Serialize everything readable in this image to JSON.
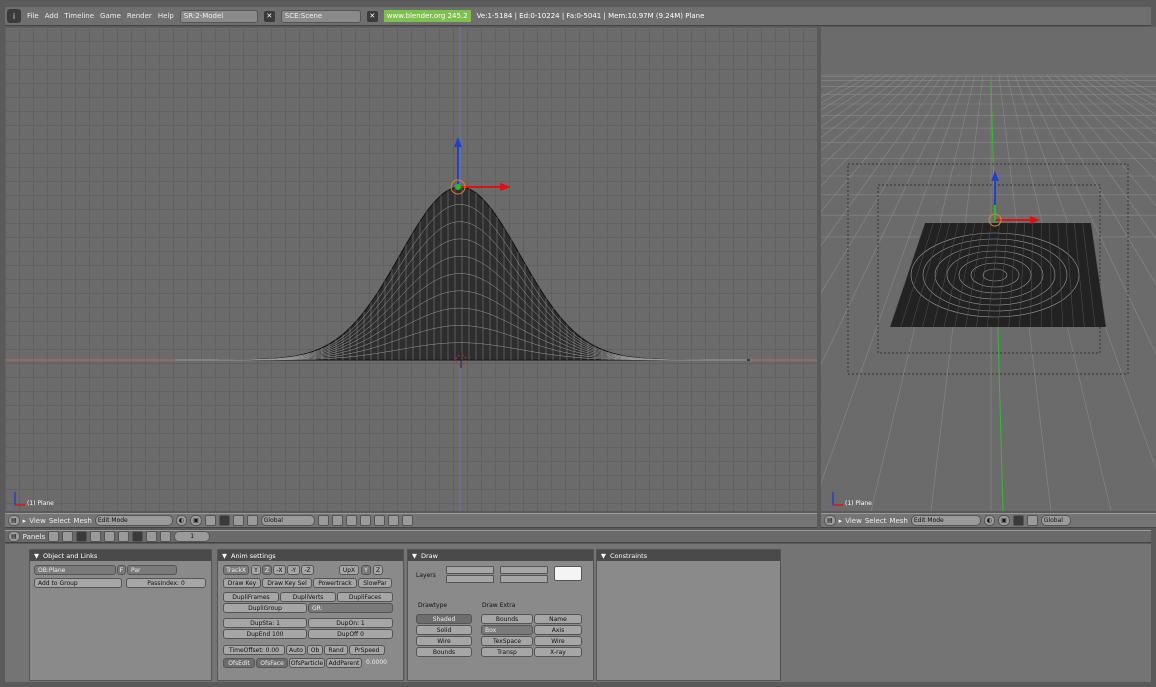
{
  "topbar": {
    "menus": [
      "File",
      "Add",
      "Timeline",
      "Game",
      "Render",
      "Help"
    ],
    "screen": "SR:2-Model",
    "scene": "SCE:Scene",
    "url": "www.blender.org 245.2",
    "stats": "Ve:1-5184 | Ed:0-10224 | Fa:0-5041 | Mem:10.97M (9.24M) Plane"
  },
  "left_view": {
    "label": "(1) Plane"
  },
  "right_view": {
    "label": "(1) Plane"
  },
  "view_header": {
    "view": "View",
    "select": "Select",
    "mesh": "Mesh",
    "mode": "Edit Mode",
    "orient": "Global"
  },
  "right_header": {
    "view": "View",
    "select": "Select",
    "mesh": "Mesh",
    "mode": "Edit Mode",
    "orient": "Global"
  },
  "buttons_header": {
    "panels": "Panels",
    "frame": "1"
  },
  "panels": {
    "object_links": {
      "title": "Object and Links",
      "ob": "OB:Plane",
      "f": "F",
      "par": "Par",
      "add_group": "Add to Group",
      "pass_index": "PassIndex: 0"
    },
    "anim": {
      "title": "Anim settings",
      "track": "TrackX",
      "track_axes": [
        "Y",
        "Z",
        "-X",
        "-Y",
        "-Z"
      ],
      "up": "UpX",
      "upy": "Y",
      "upz": "Z",
      "row2": [
        "Draw Key",
        "Draw Key Sel",
        "Powertrack",
        "SlowPar"
      ],
      "row3": [
        "DupliFrames",
        "DupliVerts",
        "DupliFaces"
      ],
      "dupligroup": "DupliGroup",
      "gr": "GR:",
      "dupsta": "DupSta: 1",
      "dupon": "DupOn: 1",
      "dupend": "DupEnd 100",
      "dupoff": "DupOff 0",
      "timeoffset": "TimeOffset: 0.00",
      "row7": [
        "Auto",
        "Ob",
        "Rand",
        "PrSpeed"
      ],
      "row8": [
        "OfsEdit",
        "OfsFace",
        "OfsParticle",
        "AddParent"
      ],
      "speed": "0.0000"
    },
    "draw": {
      "title": "Draw",
      "layers": "Layers",
      "drawtype": "Drawtype",
      "drawextra": "Draw Extra",
      "types": [
        "Shaded",
        "Solid",
        "Wire",
        "Bounds"
      ],
      "extra": [
        "Bounds",
        "Name",
        "Box",
        "Axis",
        "TexSpace",
        "Wire",
        "Transp",
        "X-ray"
      ]
    },
    "constraints": {
      "title": "Constraints"
    }
  },
  "colors": {
    "axis_x": "#e01010",
    "axis_y": "#1fc11f",
    "axis_z": "#2040d0"
  }
}
